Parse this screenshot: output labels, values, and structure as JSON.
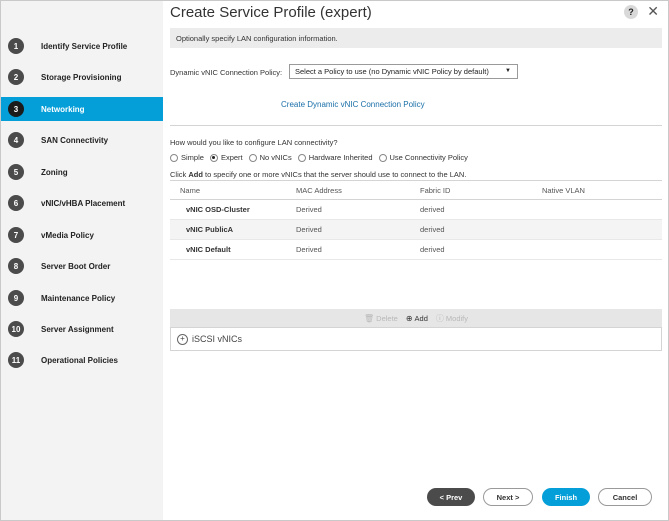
{
  "title": "Create Service Profile (expert)",
  "help_label": "?",
  "close_label": "✕",
  "info_text": "Optionally specify LAN configuration information.",
  "policy": {
    "label": "Dynamic vNIC Connection Policy:",
    "selected": "Select a Policy to use (no Dynamic vNIC Policy by default)",
    "create_link": "Create Dynamic vNIC Connection Policy"
  },
  "sidebar": {
    "items": [
      {
        "num": "1",
        "label": "Identify Service Profile"
      },
      {
        "num": "2",
        "label": "Storage Provisioning"
      },
      {
        "num": "3",
        "label": "Networking"
      },
      {
        "num": "4",
        "label": "SAN Connectivity"
      },
      {
        "num": "5",
        "label": "Zoning"
      },
      {
        "num": "6",
        "label": "vNIC/vHBA Placement"
      },
      {
        "num": "7",
        "label": "vMedia Policy"
      },
      {
        "num": "8",
        "label": "Server Boot Order"
      },
      {
        "num": "9",
        "label": "Maintenance Policy"
      },
      {
        "num": "10",
        "label": "Server Assignment"
      },
      {
        "num": "11",
        "label": "Operational Policies"
      }
    ],
    "active_index": 2
  },
  "lan": {
    "question": "How would you like to configure LAN connectivity?",
    "options": [
      "Simple",
      "Expert",
      "No vNICs",
      "Hardware Inherited",
      "Use Connectivity Policy"
    ],
    "selected": "Expert",
    "hint_pre": "Click ",
    "hint_bold": "Add",
    "hint_post": " to specify one or more vNICs that the server should use to connect to the LAN."
  },
  "table": {
    "columns": [
      "Name",
      "MAC Address",
      "Fabric ID",
      "Native VLAN"
    ],
    "rows": [
      [
        "vNIC OSD-Cluster",
        "Derived",
        "derived",
        ""
      ],
      [
        "vNIC PublicA",
        "Derived",
        "derived",
        ""
      ],
      [
        "vNIC Default",
        "Derived",
        "derived",
        ""
      ]
    ],
    "footer": {
      "delete": "Delete",
      "add": "Add",
      "modify": "Modify"
    }
  },
  "iscsi_label": "iSCSI vNICs",
  "buttons": {
    "prev": "< Prev",
    "next": "Next >",
    "finish": "Finish",
    "cancel": "Cancel"
  }
}
